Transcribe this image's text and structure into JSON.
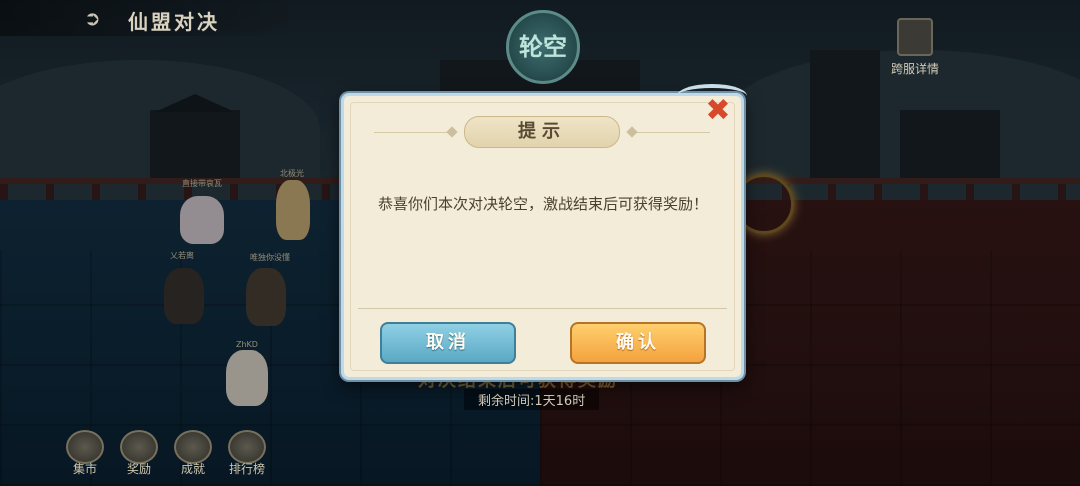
{
  "header": {
    "title": "仙盟对决",
    "emblem_text": "轮空",
    "server_detail_label": "跨服详情"
  },
  "characters": {
    "names": [
      "直接带哀瓦",
      "北极光",
      "乂若离",
      "唯独你没懂",
      "ZhKD"
    ]
  },
  "arena": {
    "behind_text": "对决结束后可获得奖励",
    "remaining_time": "剩余时间:1天16时"
  },
  "bottom_nav": [
    {
      "label": "集市",
      "icon": "market-icon"
    },
    {
      "label": "奖励",
      "icon": "gift-icon"
    },
    {
      "label": "成就",
      "icon": "achievement-icon"
    },
    {
      "label": "排行榜",
      "icon": "ranking-icon"
    }
  ],
  "dialog": {
    "title": "提示",
    "message": "恭喜你们本次对决轮空，激战结束后可获得奖励！",
    "cancel_label": "取消",
    "confirm_label": "确认",
    "close_icon": "close-icon"
  },
  "colors": {
    "cancel": "#5aa8c4",
    "confirm": "#f4a23e",
    "close": "#d8492c",
    "dialog_bg": "#f3ecd9"
  }
}
